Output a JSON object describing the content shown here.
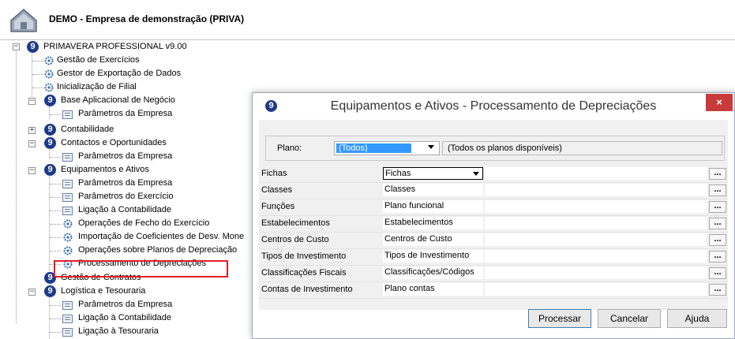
{
  "header": {
    "title": "DEMO - Empresa de demonstração (PRIVA)",
    "logo_icon": "house-logo-icon"
  },
  "tree": {
    "root": "PRIMAVERA PROFESSIONAL v9.00",
    "items": [
      "Gestão de Exercícios",
      "Gestor de Exportação de Dados",
      "Inicialização de Filial",
      "Base Aplicacional de Negócio",
      "Parâmetros da Empresa",
      "Contabilidade",
      "Contactos e Oportunidades",
      "Parâmetros da Empresa",
      "Equipamentos e Ativos",
      "Parâmetros da Empresa",
      "Parâmetros do Exercício",
      "Ligação à Contabilidade",
      "Operações de Fecho do Exercício",
      "Importação de Coeficientes de Desv. Mone",
      "Operações sobre Planos de Depreciação",
      "Processamento de Depreciações",
      "Gestão de Contratos",
      "Logística e Tesouraria",
      "Parâmetros da Empresa",
      "Ligação à Contabilidade",
      "Ligação à Tesouraria"
    ]
  },
  "dialog": {
    "title": "Equipamentos e Ativos - Processamento de Depreciações",
    "close": "×",
    "plano_label": "Plano:",
    "plano_value": "(Todos)",
    "plano_desc": "(Todos os planos disponíveis)",
    "rows": [
      {
        "label": "Fichas",
        "value": "Fichas"
      },
      {
        "label": "Classes",
        "value": "Classes"
      },
      {
        "label": "Funções",
        "value": "Plano funcional"
      },
      {
        "label": "Estabelecimentos",
        "value": "Estabelecimentos"
      },
      {
        "label": "Centros de Custo",
        "value": "Centros de Custo"
      },
      {
        "label": "Tipos de Investimento",
        "value": "Tipos de Investimento"
      },
      {
        "label": "Classificações Fiscais",
        "value": "Classificações/Códigos"
      },
      {
        "label": "Contas de Investimento",
        "value": "Plano contas"
      }
    ],
    "dots": "...",
    "buttons": {
      "process": "Processar",
      "cancel": "Cancelar",
      "help": "Ajuda"
    }
  },
  "colors": {
    "highlight": "#e21f26",
    "brand": "#1e3a8a",
    "selection": "#3399ff",
    "close": "#c93a3a"
  }
}
